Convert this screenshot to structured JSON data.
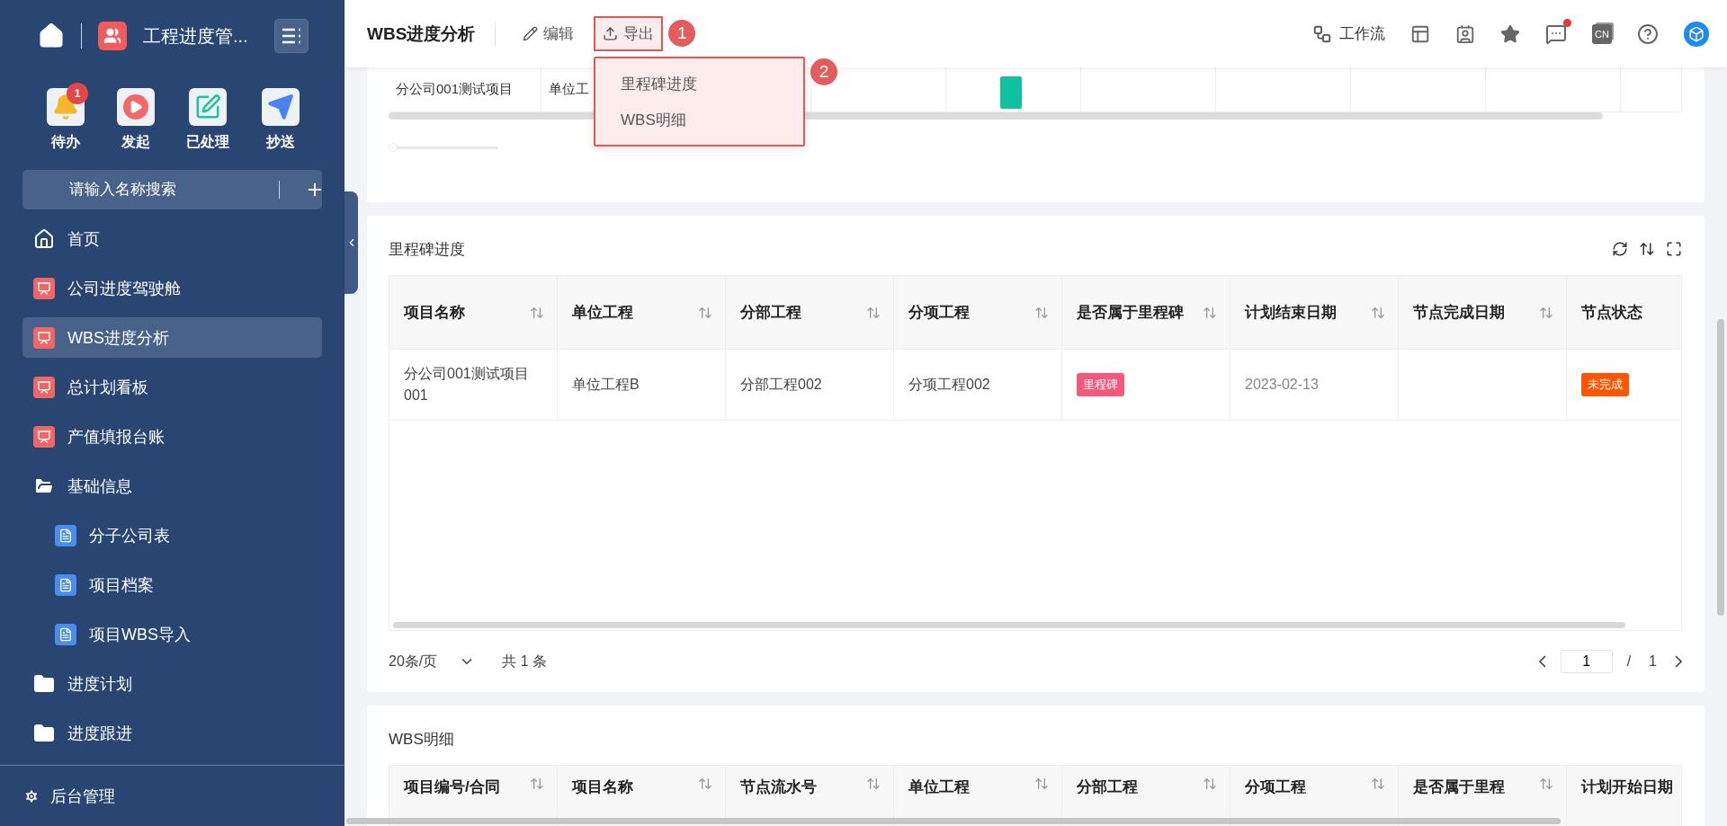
{
  "sidebar": {
    "app_title": "工程进度管...",
    "quick_actions": [
      {
        "label": "待办",
        "kind": "todo",
        "badge": "1"
      },
      {
        "label": "发起",
        "kind": "start"
      },
      {
        "label": "已处理",
        "kind": "done"
      },
      {
        "label": "抄送",
        "kind": "cc"
      }
    ],
    "search": {
      "placeholder": "请输入名称搜索"
    },
    "nav": [
      {
        "label": "首页",
        "kind": "home",
        "selected": false
      },
      {
        "label": "公司进度驾驶舱",
        "kind": "report",
        "selected": false
      },
      {
        "label": "WBS进度分析",
        "kind": "report",
        "selected": true
      },
      {
        "label": "总计划看板",
        "kind": "report",
        "selected": false
      },
      {
        "label": "产值填报台账",
        "kind": "report",
        "selected": false
      },
      {
        "label": "基础信息",
        "kind": "folder",
        "selected": false,
        "expanded": true,
        "children": [
          {
            "label": "分子公司表",
            "kind": "doc",
            "selected": false
          },
          {
            "label": "项目档案",
            "kind": "doc",
            "selected": false
          },
          {
            "label": "项目WBS导入",
            "kind": "doc",
            "selected": false
          }
        ]
      },
      {
        "label": "进度计划",
        "kind": "folder",
        "selected": false,
        "expanded": false
      },
      {
        "label": "进度跟进",
        "kind": "folder",
        "selected": false,
        "expanded": false
      }
    ],
    "footer": "后台管理"
  },
  "toolbar": {
    "title": "WBS进度分析",
    "actions": [
      {
        "label": "编辑",
        "kind": "edit"
      },
      {
        "label": "导出",
        "kind": "export",
        "callout": "1"
      }
    ],
    "export_menu": {
      "callout": "2",
      "items": [
        "里程碑进度",
        "WBS明细"
      ]
    },
    "workflow": "工作流",
    "language": "CN",
    "messages_unread": true
  },
  "gantt_strip": {
    "cells": [
      "分公司001测试项目",
      "单位工"
    ],
    "zoom": {
      "level": 0
    }
  },
  "milestones": {
    "title": "里程碑进度",
    "columns": [
      {
        "label": "项目名称",
        "sortable": true
      },
      {
        "label": "单位工程",
        "sortable": true
      },
      {
        "label": "分部工程",
        "sortable": true
      },
      {
        "label": "分项工程",
        "sortable": true
      },
      {
        "label": "是否属于里程碑",
        "sortable": true
      },
      {
        "label": "计划结束日期",
        "sortable": true
      },
      {
        "label": "节点完成日期",
        "sortable": true
      },
      {
        "label": "节点状态"
      }
    ],
    "rows": [
      [
        {
          "text": "分公司001测试项目001"
        },
        {
          "text": "单位工程B"
        },
        {
          "text": "分部工程002"
        },
        {
          "text": "分项工程002"
        },
        {
          "text": "里程碑",
          "kind": "tag",
          "color": "#f5587b"
        },
        {
          "text": "2023-02-13",
          "kind": "muted"
        },
        {
          "text": ""
        },
        {
          "text": "未完成",
          "kind": "tag",
          "color": "#ff5500"
        }
      ]
    ],
    "page_size": "20条/页",
    "total": "共 1 条",
    "page": "1",
    "separator": "/",
    "pages": "1"
  },
  "wbs": {
    "title": "WBS明细",
    "columns": [
      {
        "label": "项目编号/合同",
        "sortable": true
      },
      {
        "label": "项目名称",
        "sortable": true
      },
      {
        "label": "节点流水号",
        "sortable": true
      },
      {
        "label": "单位工程",
        "sortable": true
      },
      {
        "label": "分部工程",
        "sortable": true
      },
      {
        "label": "分项工程",
        "sortable": true
      },
      {
        "label": "是否属于里程",
        "sortable": true
      },
      {
        "label": "计划开始日期"
      }
    ]
  }
}
